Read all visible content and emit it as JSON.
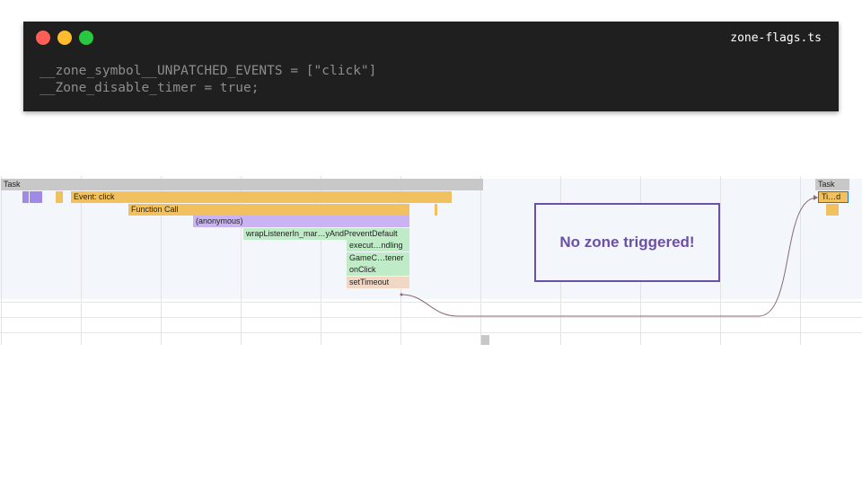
{
  "code_window": {
    "filename": "zone-flags.ts",
    "lines": [
      "__zone_symbol__UNPATCHED_EVENTS = [\"click\"]",
      "__Zone_disable_timer = true;"
    ]
  },
  "flame_chart": {
    "task_label": "Task",
    "event_label": "Event: click",
    "function_call_label": "Function Call",
    "anonymous_label": "(anonymous)",
    "wrap_listener_label": "wrapListenerIn_mar…yAndPreventDefault",
    "execute_label": "execut…ndling",
    "game_listener_label": "GameC…tener",
    "onclick_label": "onClick",
    "settimeout_label": "setTimeout",
    "task2_label": "Task",
    "timer_label": "Ti…d"
  },
  "annotation": {
    "text": "No zone triggered!",
    "color": "#6a50a7"
  },
  "colors": {
    "task": "#c8c8c8",
    "scripting": "#f0c15e",
    "anonymous": "#c9b3f3",
    "framework": "#bfecc6",
    "timer": "#f3d7c5"
  }
}
